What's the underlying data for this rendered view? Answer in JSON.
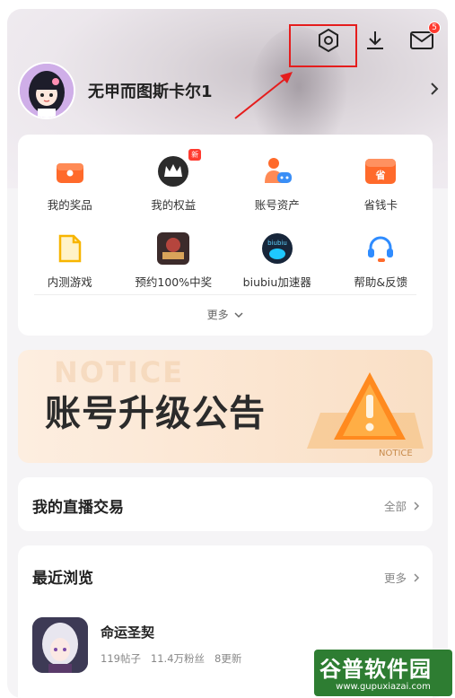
{
  "header": {
    "username": "无甲而图斯卡尔1",
    "message_badge": "5"
  },
  "quick_grid": {
    "items": [
      {
        "label": "我的奖品",
        "icon": "gift-box-icon"
      },
      {
        "label": "我的权益",
        "icon": "crown-avatar-icon",
        "tag": "新"
      },
      {
        "label": "账号资产",
        "icon": "account-assets-icon"
      },
      {
        "label": "省钱卡",
        "icon": "savings-card-icon",
        "icon_text": "省"
      },
      {
        "label": "内测游戏",
        "icon": "beta-doc-icon"
      },
      {
        "label": "预约100%中奖",
        "icon": "reservation-game-icon"
      },
      {
        "label": "biubiu加速器",
        "icon": "biubiu-accelerator-icon",
        "icon_text": "biubiu"
      },
      {
        "label": "帮助&反馈",
        "icon": "headset-icon"
      }
    ],
    "more_label": "更多"
  },
  "banner": {
    "bg_text": "NOTICE",
    "title": "账号升级公告",
    "badge_text": "NOTICE"
  },
  "live_trade": {
    "title": "我的直播交易",
    "link": "全部"
  },
  "recent": {
    "title": "最近浏览",
    "link": "更多",
    "games": [
      {
        "name": "命运圣契",
        "posts": "119帖子",
        "fans": "11.4万粉丝",
        "updates": "8更新"
      }
    ]
  },
  "watermark": {
    "title": "谷普软件园",
    "url": "www.gupuxiazai.com"
  },
  "colors": {
    "accent_orange": "#ff6a2b",
    "badge_red": "#ff3b30",
    "highlight_red": "#e51d1d"
  }
}
